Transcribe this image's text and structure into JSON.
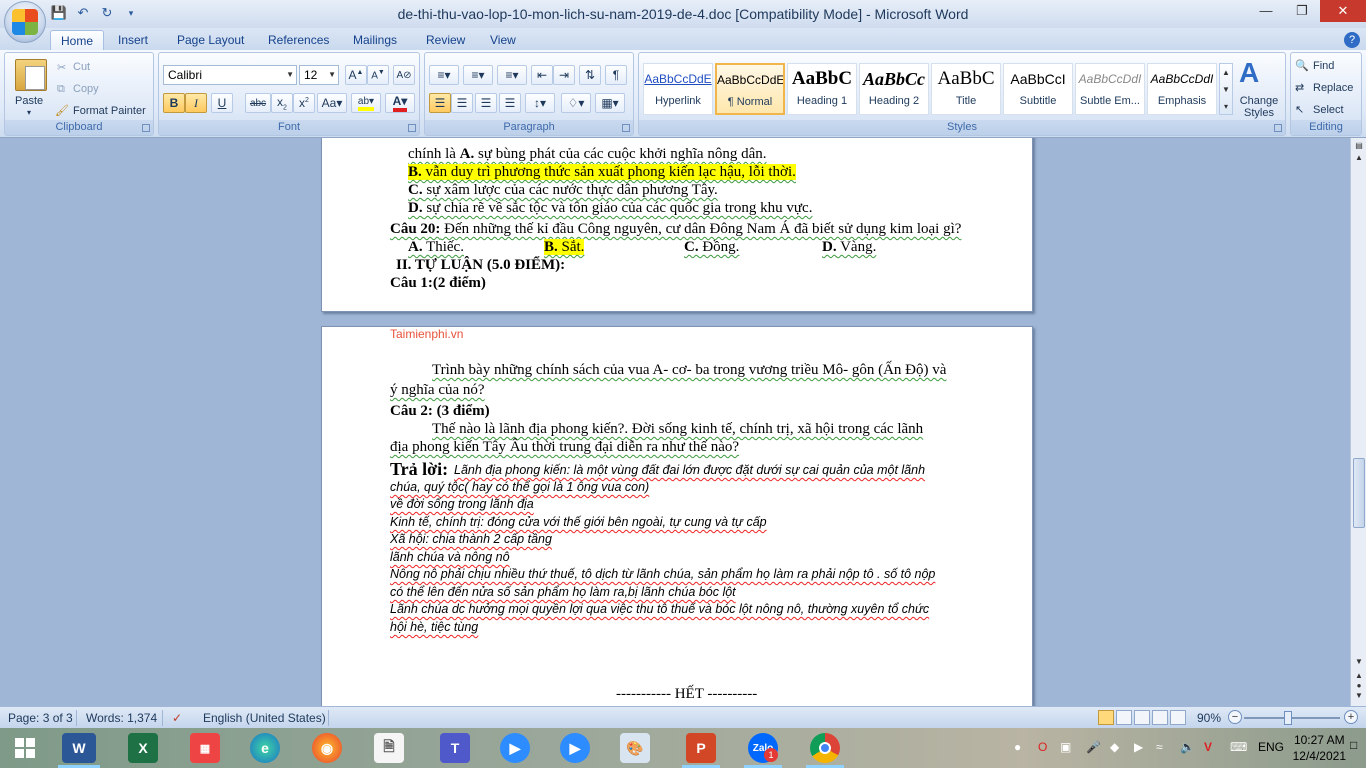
{
  "app": {
    "title": "de-thi-thu-vao-lop-10-mon-lich-su-nam-2019-de-4.doc [Compatibility Mode] - Microsoft Word"
  },
  "tabs": [
    "Home",
    "Insert",
    "Page Layout",
    "References",
    "Mailings",
    "Review",
    "View"
  ],
  "ribbon": {
    "clipboard": {
      "label": "Clipboard",
      "paste": "Paste",
      "cut": "Cut",
      "copy": "Copy",
      "format_painter": "Format Painter"
    },
    "font": {
      "label": "Font",
      "family": "Calibri",
      "size": "12"
    },
    "paragraph": {
      "label": "Paragraph"
    },
    "styles": {
      "label": "Styles",
      "items": [
        {
          "preview": "AaBbCcDdE",
          "name": "Hyperlink"
        },
        {
          "preview": "AaBbCcDdE",
          "name": "¶ Normal"
        },
        {
          "preview": "AaBbC",
          "name": "Heading 1"
        },
        {
          "preview": "AaBbCc",
          "name": "Heading 2"
        },
        {
          "preview": "AaBbC",
          "name": "Title"
        },
        {
          "preview": "AaBbCcI",
          "name": "Subtitle"
        },
        {
          "preview": "AaBbCcDdI",
          "name": "Subtle Em..."
        },
        {
          "preview": "AaBbCcDdI",
          "name": "Emphasis"
        }
      ],
      "change_styles": "Change Styles"
    },
    "editing": {
      "label": "Editing",
      "find": "Find",
      "replace": "Replace",
      "select": "Select"
    }
  },
  "document": {
    "page1": {
      "l1a": "chính là ",
      "l1b": "A.",
      "l1c": " sự bùng phát của các cuộc khởi nghĩa nông dân.",
      "l2a": "B.",
      "l2b": " vẫn duy trì phương thức sản xuất phong kiến lạc hậu, lỗi thời.",
      "l3a": "C.",
      "l3b": " sự xâm lược của các nước thực dân phương Tây.",
      "l4a": "D.",
      "l4b": " sự chia rẽ về sắc tộc và tôn giáo của các quốc gia trong khu vực.",
      "q20a": "Câu 20:",
      "q20b": " Đến những thế kỉ đầu Công nguyên, cư dân Đông Nam Á đã biết sử dụng kim loại gì?",
      "optA1": "A.",
      "optA2": " Thiếc.",
      "optB1": "B.",
      "optB2": " Sắt.",
      "optC1": "C.",
      "optC2": " Đồng.",
      "optD1": "D.",
      "optD2": " Vàng.",
      "section": "II. TỰ LUẬN (5.0 ĐIỂM):",
      "cau1": "Câu 1:(2 điểm)"
    },
    "page2": {
      "watermark": "Taimienphi.vn",
      "p1": "Trình bày những chính sách của vua A- cơ- ba trong vương triều Mô- gôn (Ấn Độ) và",
      "p1b": "ý nghĩa của nó?",
      "cau2": "Câu 2: (3 điểm)",
      "p2": "Thế nào là lãnh địa phong kiến?. Đời sống kinh tế, chính trị, xã hội trong các lãnh",
      "p2b": "địa phong kiến Tây Âu thời trung đại diễn ra như thế nào?",
      "tra_loi": "Trả lời:",
      "a1": "Lãnh địa phong kiến: là một vùng đất đai lớn được đặt dưới sự cai quản của một lãnh",
      "a2": "chúa, quý tộc( hay có thể gọi là 1 ông vua con)",
      "a3": "về đời sống trong lãnh địa",
      "a4": "Kinh tế, chính trị: đóng cửa với thế giới bên ngoài,  tự cung và tự cấp",
      "a5": "Xã hội:  chia thành  2 cấp tầng",
      "a6": "lãnh chúa và nông nô",
      "a7": "Nông nô phải chịu nhiều thứ thuế, tô dịch từ lãnh chúa, sản phẩm  họ làm ra phải nộp tô . số tô nộp",
      "a8": "có thể lên đến nửa số sản phẩm  họ làm ra,bị lãnh  chúa bóc lột",
      "a9": "Lãnh chúa dc hưởng mọi quyền lợi qua việc thu tô thuế và bóc lột nông  nô, thường xuyên tổ chức",
      "a10": "hội hè, tiệc tùng",
      "end": "----------- HẾT ----------"
    }
  },
  "status": {
    "page": "Page: 3 of 3",
    "words": "Words: 1,374",
    "language": "English (United States)",
    "zoom": "90%",
    "zoom_level": 0.9
  },
  "taskbar": {
    "lang": "ENG",
    "time": "10:27 AM",
    "date": "12/4/2021",
    "zalo_badge": "1",
    "zalo_label": "Zalo"
  }
}
